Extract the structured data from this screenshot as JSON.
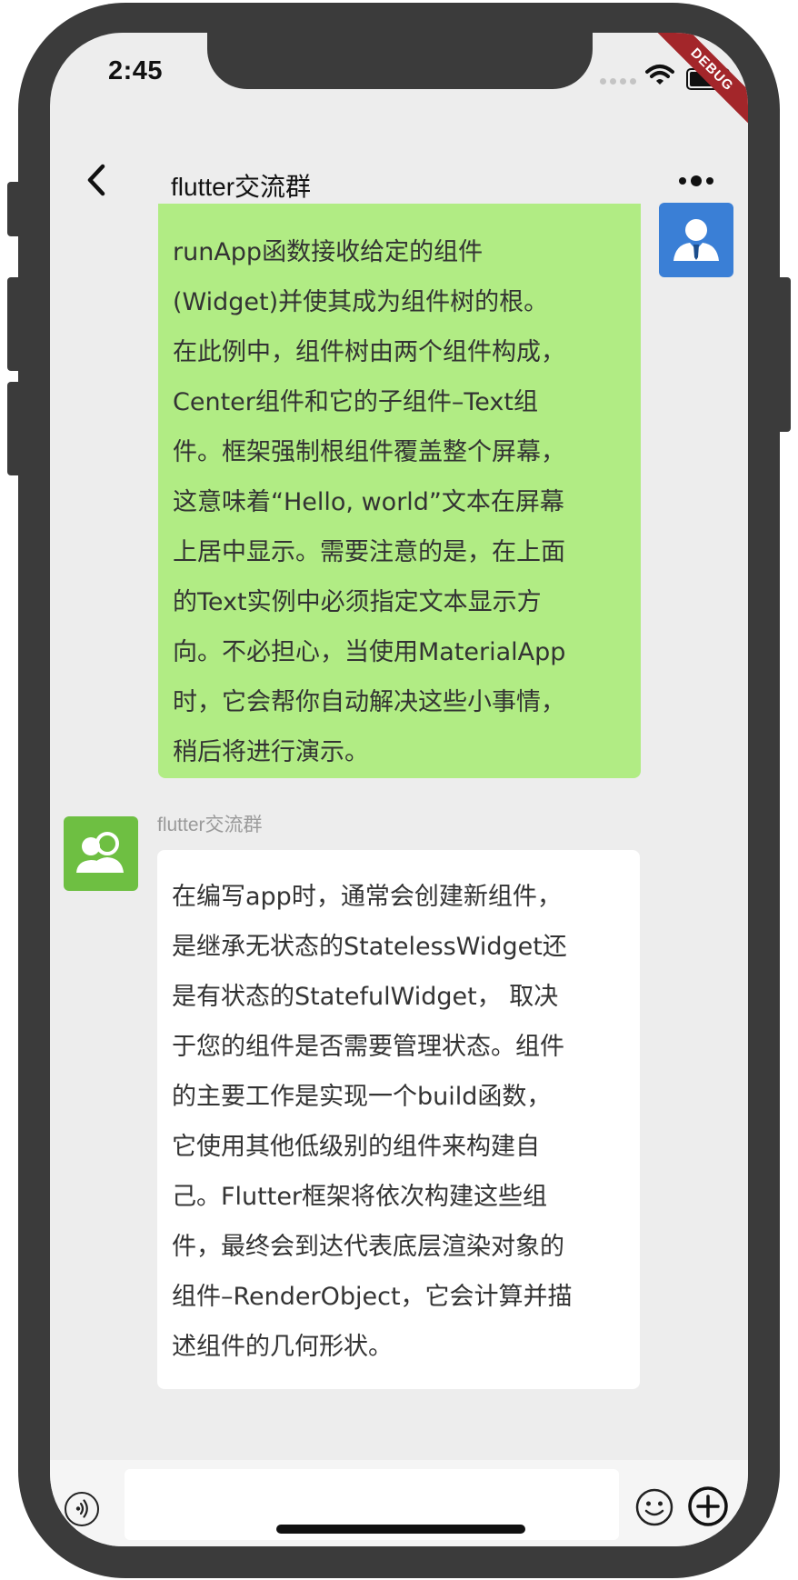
{
  "status_bar": {
    "time": "2:45",
    "debug_banner": "DEBUG"
  },
  "app_bar": {
    "title": "flutter交流群"
  },
  "icons": {
    "back": "chevron-left-icon",
    "more": "more-dots-icon",
    "voice": "voice-icon",
    "emoji": "emoji-icon",
    "add": "plus-circle-icon"
  },
  "colors": {
    "sent_bubble": "#b1ec84",
    "received_bubble": "#ffffff",
    "my_avatar": "#3a7fd6",
    "group_avatar": "#6ebf42",
    "background": "#ededed"
  },
  "messages": [
    {
      "direction": "sent",
      "lines": [
        "runApp函数接收给定的组件",
        "(Widget)并使其成为组件树的根。",
        "在此例中，组件树由两个组件构成，",
        "Center组件和它的子组件–Text组",
        "件。框架强制根组件覆盖整个屏幕，",
        "这意味着“Hello, world”文本在屏幕",
        "上居中显示。需要注意的是，在上面",
        "的Text实例中必须指定文本显示方",
        "向。不必担心，当使用MaterialApp",
        "时，它会帮你自动解决这些小事情，",
        "稍后将进行演示。"
      ]
    },
    {
      "direction": "received",
      "sender": "flutter交流群",
      "lines": [
        "在编写app时，通常会创建新组件，",
        "是继承无状态的StatelessWidget还",
        "是有状态的StatefulWidget， 取决",
        "于您的组件是否需要管理状态。组件",
        "的主要工作是实现一个build函数，",
        "它使用其他低级别的组件来构建自",
        "己。Flutter框架将依次构建这些组",
        "件，最终会到达代表底层渲染对象的",
        "组件–RenderObject，它会计算并描",
        "述组件的几何形状。"
      ]
    }
  ]
}
